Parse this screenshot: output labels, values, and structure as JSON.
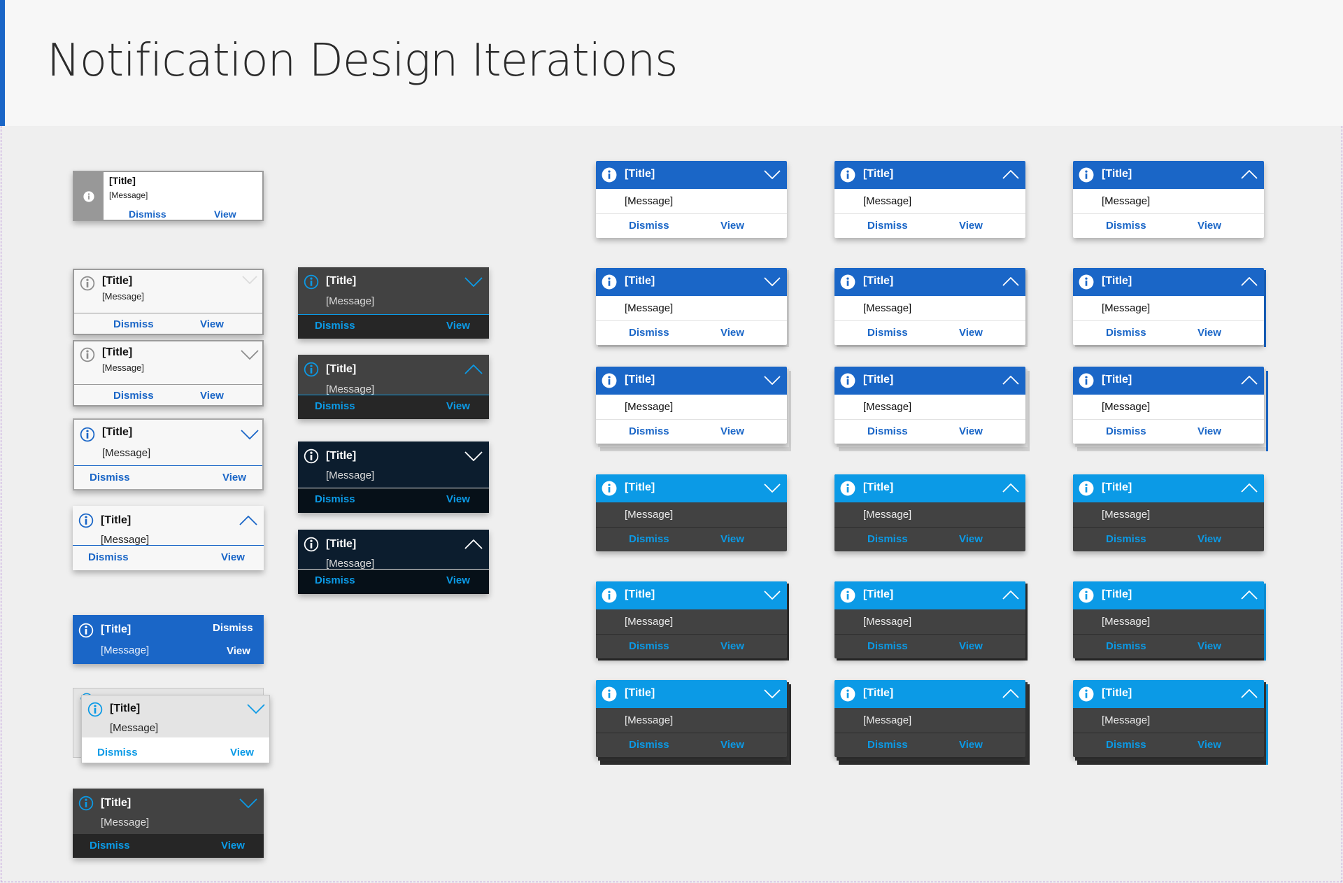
{
  "page": {
    "title": "Notification Design Iterations"
  },
  "notification": {
    "title": "[Title]",
    "message": "[Message]",
    "dismiss": "Dismiss",
    "view": "View"
  },
  "colors": {
    "primary_blue": "#1a66c7",
    "light_blue": "#0b9ae6",
    "dark_gray": "#424242",
    "darker_gray": "#262626",
    "navy": "#0c1d2e",
    "light_card": "#f7f7f7"
  },
  "icons": [
    "info-icon",
    "chevron-down-icon",
    "chevron-up-icon"
  ]
}
